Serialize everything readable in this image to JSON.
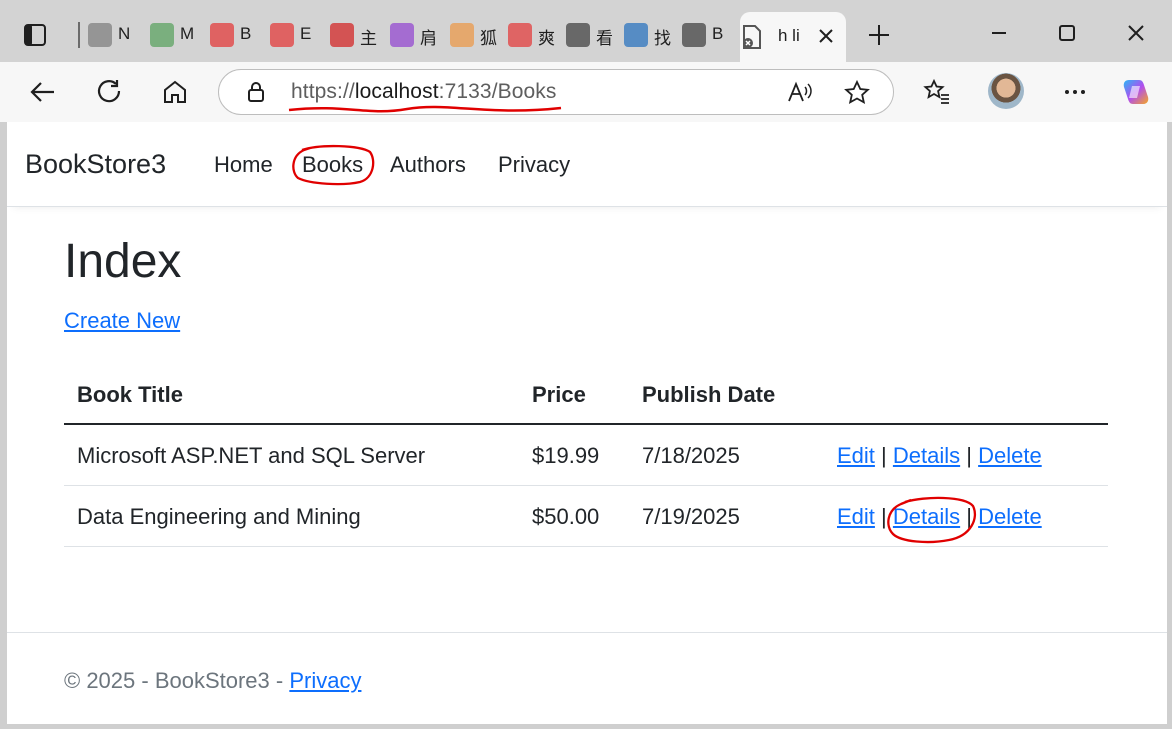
{
  "browser": {
    "tabs": [
      {
        "icon": "calendar-icon",
        "text": "N",
        "color": "#8a8a8a"
      },
      {
        "icon": "und-icon",
        "text": "M",
        "color": "#6aa86f"
      },
      {
        "icon": "opera-icon",
        "text": "B",
        "color": "#e04d4d"
      },
      {
        "icon": "opera-icon",
        "text": "E",
        "color": "#e04d4d"
      },
      {
        "icon": "w-logo-icon",
        "text": "主",
        "color": "#d23c3c"
      },
      {
        "icon": "slash-icon",
        "text": "肩",
        "color": "#9b59d0"
      },
      {
        "icon": "face-icon",
        "text": "狐",
        "color": "#e8a05a"
      },
      {
        "icon": "zhong-icon",
        "text": "爽",
        "color": "#e05050"
      },
      {
        "icon": "globe-icon",
        "text": "看",
        "color": "#555555"
      },
      {
        "icon": "edit-icon",
        "text": "找",
        "color": "#3f7fc1"
      },
      {
        "icon": "globe-icon",
        "text": "B",
        "color": "#555555"
      }
    ],
    "active_tab": {
      "text": "h li",
      "icon": "page-error-icon"
    },
    "url": {
      "scheme": "https://",
      "host": "localhost",
      "rest": ":7133/Books"
    },
    "annotation_color": "#e00000"
  },
  "site": {
    "brand": "BookStore3",
    "nav": [
      "Home",
      "Books",
      "Authors",
      "Privacy"
    ],
    "page_title": "Index",
    "create_new": "Create New",
    "columns": [
      "Book Title",
      "Price",
      "Publish Date"
    ],
    "rows": [
      {
        "title": "Microsoft ASP.NET and SQL Server",
        "price": "$19.99",
        "date": "7/18/2025"
      },
      {
        "title": "Data Engineering and Mining",
        "price": "$50.00",
        "date": "7/19/2025"
      }
    ],
    "actions": {
      "edit": "Edit",
      "sep": "|",
      "details": "Details",
      "delete": "Delete"
    },
    "footer": {
      "text": "© 2025 - BookStore3 - ",
      "privacy": "Privacy"
    }
  }
}
